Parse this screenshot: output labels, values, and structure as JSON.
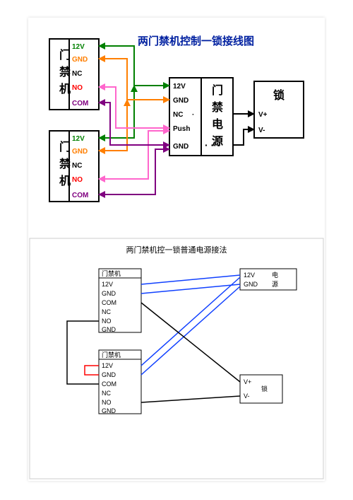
{
  "diagram1": {
    "title": "两门禁机控制一锁接线图",
    "accessController": {
      "name": "门禁机",
      "pins": [
        {
          "key": "12V",
          "label": "12V",
          "color": "#008000"
        },
        {
          "key": "GND",
          "label": "GND",
          "color": "#ff7f00"
        },
        {
          "key": "NC",
          "label": "NC",
          "color": "#000000"
        },
        {
          "key": "NO",
          "label": "NO",
          "color": "#ff0000"
        },
        {
          "key": "COM",
          "label": "COM",
          "color": "#800080"
        }
      ]
    },
    "powerSupply": {
      "name": "门禁电源",
      "pins": [
        {
          "key": "12V",
          "label": "12V"
        },
        {
          "key": "GND",
          "label": "GND"
        },
        {
          "key": "NC",
          "label": "NC"
        },
        {
          "key": "Push",
          "label": "Push"
        },
        {
          "key": "GND2",
          "label": "GND"
        }
      ],
      "dotsLabel": "· · ·"
    },
    "lock": {
      "name": "锁",
      "pins": [
        {
          "key": "Vp",
          "label": "V+"
        },
        {
          "key": "Vm",
          "label": "V-"
        }
      ]
    },
    "wires": [
      {
        "from": "AC1.12V",
        "to": "PS.12V",
        "color": "#008000"
      },
      {
        "from": "AC2.12V",
        "to": "PS.12V",
        "color": "#008000"
      },
      {
        "from": "AC1.GND",
        "to": "PS.GND",
        "color": "#ff7f00"
      },
      {
        "from": "AC2.GND",
        "to": "PS.GND",
        "color": "#ff7f00"
      },
      {
        "from": "AC1.COM",
        "to": "PS.GND2",
        "color": "#800080"
      },
      {
        "from": "AC2.COM",
        "to": "PS.GND2",
        "color": "#800080"
      },
      {
        "from": "AC1.NO",
        "to": "PS.Push",
        "color": "#ff66cc"
      },
      {
        "from": "AC2.NO",
        "to": "PS.Push",
        "color": "#ff66cc"
      },
      {
        "from": "PS.NC",
        "to": "LOCK.Vp",
        "color": "#000000"
      },
      {
        "from": "PS.dots",
        "to": "LOCK.Vm",
        "color": "#000000"
      }
    ]
  },
  "diagram2": {
    "title": "两门禁机控一锁普通电源接法",
    "accessController": {
      "name": "门禁机",
      "pins": [
        "12V",
        "GND",
        "COM",
        "NC",
        "NO",
        "GND"
      ]
    },
    "powerSupply": {
      "name": "电源",
      "pins": [
        "12V",
        "GND"
      ]
    },
    "lock": {
      "name": "锁",
      "pins": [
        "V+",
        "V-"
      ]
    },
    "wires": [
      {
        "from": "AC1.12V",
        "to": "PS.12V",
        "color": "#1040ff"
      },
      {
        "from": "AC1.GND",
        "to": "PS.GND",
        "color": "#1040ff"
      },
      {
        "from": "AC2.12V",
        "to": "PS.12V",
        "color": "#1040ff"
      },
      {
        "from": "AC2.GND",
        "to": "PS.GND",
        "color": "#1040ff"
      },
      {
        "from": "AC1.COM",
        "to": "LOCK.Vp",
        "color": "#000"
      },
      {
        "from": "AC1.NO",
        "to": "AC2.COM",
        "color": "#000"
      },
      {
        "from": "AC2.NO",
        "to": "LOCK.Vm",
        "color": "#000"
      },
      {
        "from": "AC2.12V",
        "to": "AC2.GND",
        "color": "#ff0000",
        "note": "short across 12V/GND on second controller (as drawn)"
      }
    ]
  }
}
